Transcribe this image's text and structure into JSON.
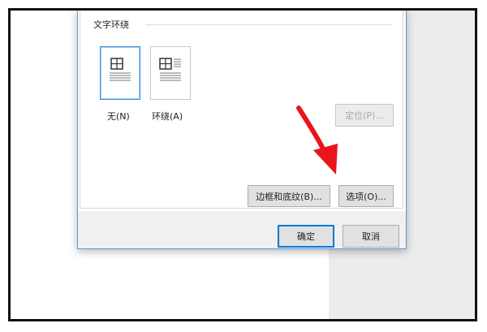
{
  "section": {
    "label": "文字环绕"
  },
  "wrap_options": [
    {
      "label": "无(N)",
      "selected": true,
      "icon": "wrap-none-icon"
    },
    {
      "label": "环绕(A)",
      "selected": false,
      "icon": "wrap-around-icon"
    }
  ],
  "buttons": {
    "position": "定位(P)...",
    "borders_shading": "边框和底纹(B)...",
    "options": "选项(O)...",
    "ok": "确定",
    "cancel": "取消"
  },
  "colors": {
    "selected_border": "#3c8ed6",
    "primary_button_border": "#0078d7",
    "annotation_arrow": "#e8151b"
  },
  "annotation": {
    "icon": "red-arrow-icon"
  }
}
